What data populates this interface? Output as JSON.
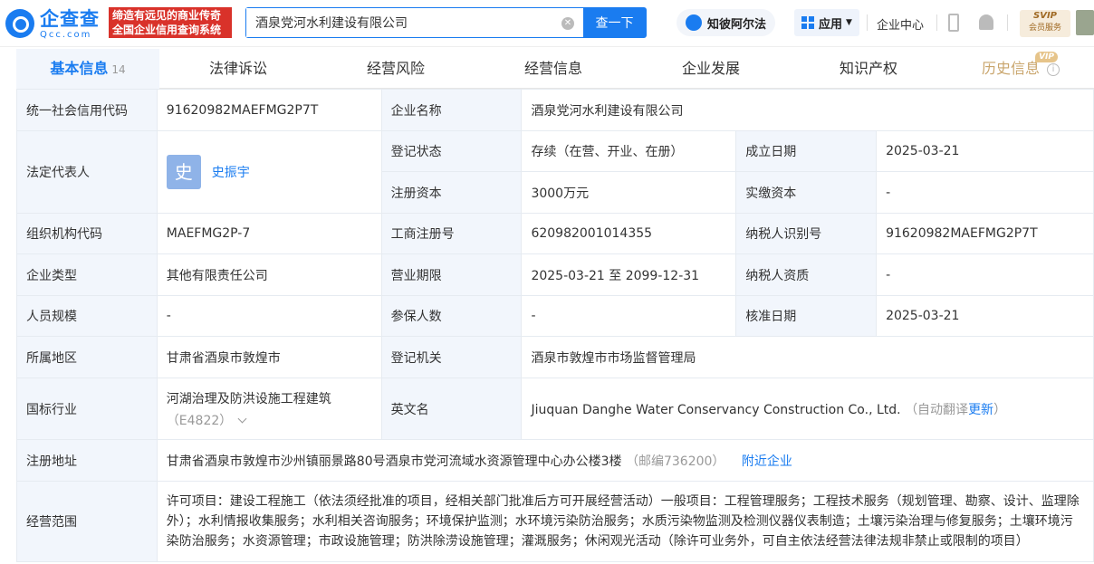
{
  "header": {
    "logo_cn": "企查查",
    "logo_en": "Qcc.com",
    "slogan_line1": "缔造有远见的商业传奇",
    "slogan_line2": "全国企业信用查询系统",
    "search_value": "酒泉党河水利建设有限公司",
    "search_button": "查一下",
    "pill_label": "知彼阿尔法",
    "app_label": "应用",
    "enterprise_center": "企业中心",
    "svip_top": "SVIP",
    "svip_bottom": "会员服务"
  },
  "tabs": [
    {
      "label": "基本信息",
      "count": "14"
    },
    {
      "label": "法律诉讼"
    },
    {
      "label": "经营风险"
    },
    {
      "label": "经营信息"
    },
    {
      "label": "企业发展"
    },
    {
      "label": "知识产权"
    },
    {
      "label": "历史信息",
      "badge": "VIP"
    }
  ],
  "info": {
    "credit_code_label": "统一社会信用代码",
    "credit_code": "91620982MAEFMG2P7T",
    "company_name_label": "企业名称",
    "company_name": "酒泉党河水利建设有限公司",
    "legal_rep_label": "法定代表人",
    "legal_rep_avatar": "史",
    "legal_rep": "史振宇",
    "reg_status_label": "登记状态",
    "reg_status": "存续（在营、开业、在册）",
    "found_date_label": "成立日期",
    "found_date": "2025-03-21",
    "reg_capital_label": "注册资本",
    "reg_capital": "3000万元",
    "paid_capital_label": "实缴资本",
    "paid_capital": "-",
    "org_code_label": "组织机构代码",
    "org_code": "MAEFMG2P-7",
    "biz_reg_no_label": "工商注册号",
    "biz_reg_no": "620982001014355",
    "taxpayer_id_label": "纳税人识别号",
    "taxpayer_id": "91620982MAEFMG2P7T",
    "company_type_label": "企业类型",
    "company_type": "其他有限责任公司",
    "term_label": "营业期限",
    "term": "2025-03-21 至 2099-12-31",
    "taxpayer_qual_label": "纳税人资质",
    "taxpayer_qual": "-",
    "staff_size_label": "人员规模",
    "staff_size": "-",
    "insured_label": "参保人数",
    "insured": "-",
    "approval_date_label": "核准日期",
    "approval_date": "2025-03-21",
    "region_label": "所属地区",
    "region": "甘肃省酒泉市敦煌市",
    "reg_authority_label": "登记机关",
    "reg_authority": "酒泉市敦煌市市场监督管理局",
    "industry_label": "国标行业",
    "industry": "河湖治理及防洪设施工程建筑",
    "industry_code": "（E4822）",
    "english_name_label": "英文名",
    "english_name": "Jiuquan Danghe Water Conservancy Construction Co., Ltd.",
    "auto_translate": "（自动翻译",
    "update_link": "更新",
    "close_paren": "）",
    "address_label": "注册地址",
    "address": "甘肃省酒泉市敦煌市沙州镇丽景路80号酒泉市党河流域水资源管理中心办公楼3楼",
    "postcode": "（邮编736200）",
    "nearby_link": "附近企业",
    "scope_label": "经营范围",
    "scope": "许可项目：建设工程施工（依法须经批准的项目，经相关部门批准后方可开展经营活动）一般项目：工程管理服务；工程技术服务（规划管理、勘察、设计、监理除外）；水利情报收集服务；水利相关咨询服务；环境保护监测；水环境污染防治服务；水质污染物监测及检测仪器仪表制造；土壤污染治理与修复服务；土壤环境污染防治服务；水资源管理；市政设施管理；防洪除涝设施管理；灌溉服务；休闲观光活动（除许可业务外，可自主依法经营法律法规非禁止或限制的项目）"
  }
}
